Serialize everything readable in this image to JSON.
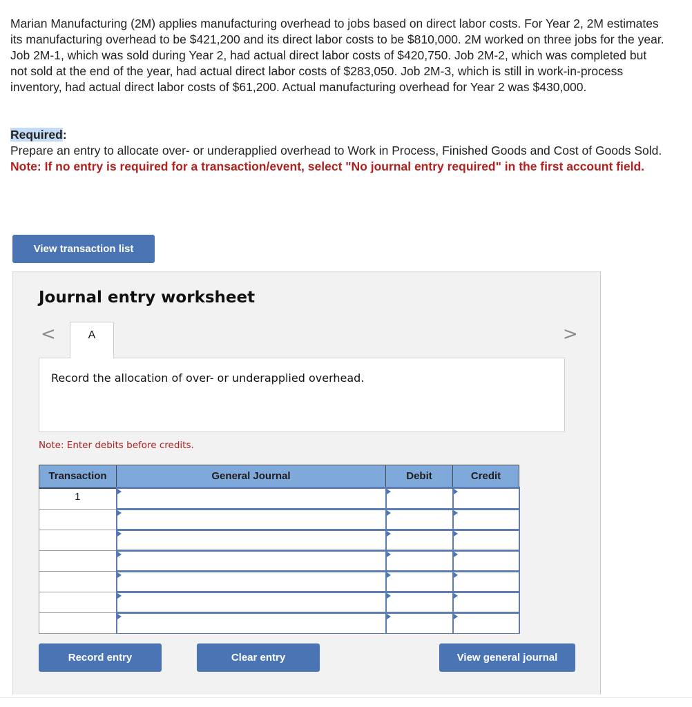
{
  "problem": {
    "text": "Marian Manufacturing (2M) applies manufacturing overhead to jobs based on direct labor costs. For Year 2, 2M estimates its manufacturing overhead to be $421,200 and its direct labor costs to be $810,000. 2M worked on three jobs for the year. Job 2M-1, which was sold during Year 2, had actual direct labor costs of $420,750. Job 2M-2, which was completed but not sold at the end of the year, had actual direct labor costs of $283,050. Job 2M-3, which is still in work-in-process inventory, had actual direct labor costs of $61,200. Actual manufacturing overhead for Year 2 was $430,000."
  },
  "required": {
    "label": "Required",
    "colon": ":",
    "instruction": "Prepare an entry to allocate over- or underapplied overhead to Work in Process, Finished Goods and Cost of Goods Sold.",
    "note": "Note: If no entry is required for a transaction/event, select \"No journal entry required\" in the first account field."
  },
  "buttons": {
    "view_transaction_list": "View transaction list",
    "record_entry": "Record entry",
    "clear_entry": "Clear entry",
    "view_general_journal": "View general journal"
  },
  "worksheet": {
    "title": "Journal entry worksheet",
    "prev_arrow": "<",
    "next_arrow": ">",
    "active_tab": "A",
    "description": "Record the allocation of over- or underapplied overhead.",
    "entry_note": "Note: Enter debits before credits."
  },
  "journal_table": {
    "headers": [
      "Transaction",
      "General Journal",
      "Debit",
      "Credit"
    ],
    "rows": [
      {
        "transaction": "1",
        "account": "",
        "debit": "",
        "credit": ""
      },
      {
        "transaction": "",
        "account": "",
        "debit": "",
        "credit": ""
      },
      {
        "transaction": "",
        "account": "",
        "debit": "",
        "credit": ""
      },
      {
        "transaction": "",
        "account": "",
        "debit": "",
        "credit": ""
      },
      {
        "transaction": "",
        "account": "",
        "debit": "",
        "credit": ""
      },
      {
        "transaction": "",
        "account": "",
        "debit": "",
        "credit": ""
      },
      {
        "transaction": "",
        "account": "",
        "debit": "",
        "credit": ""
      }
    ]
  }
}
